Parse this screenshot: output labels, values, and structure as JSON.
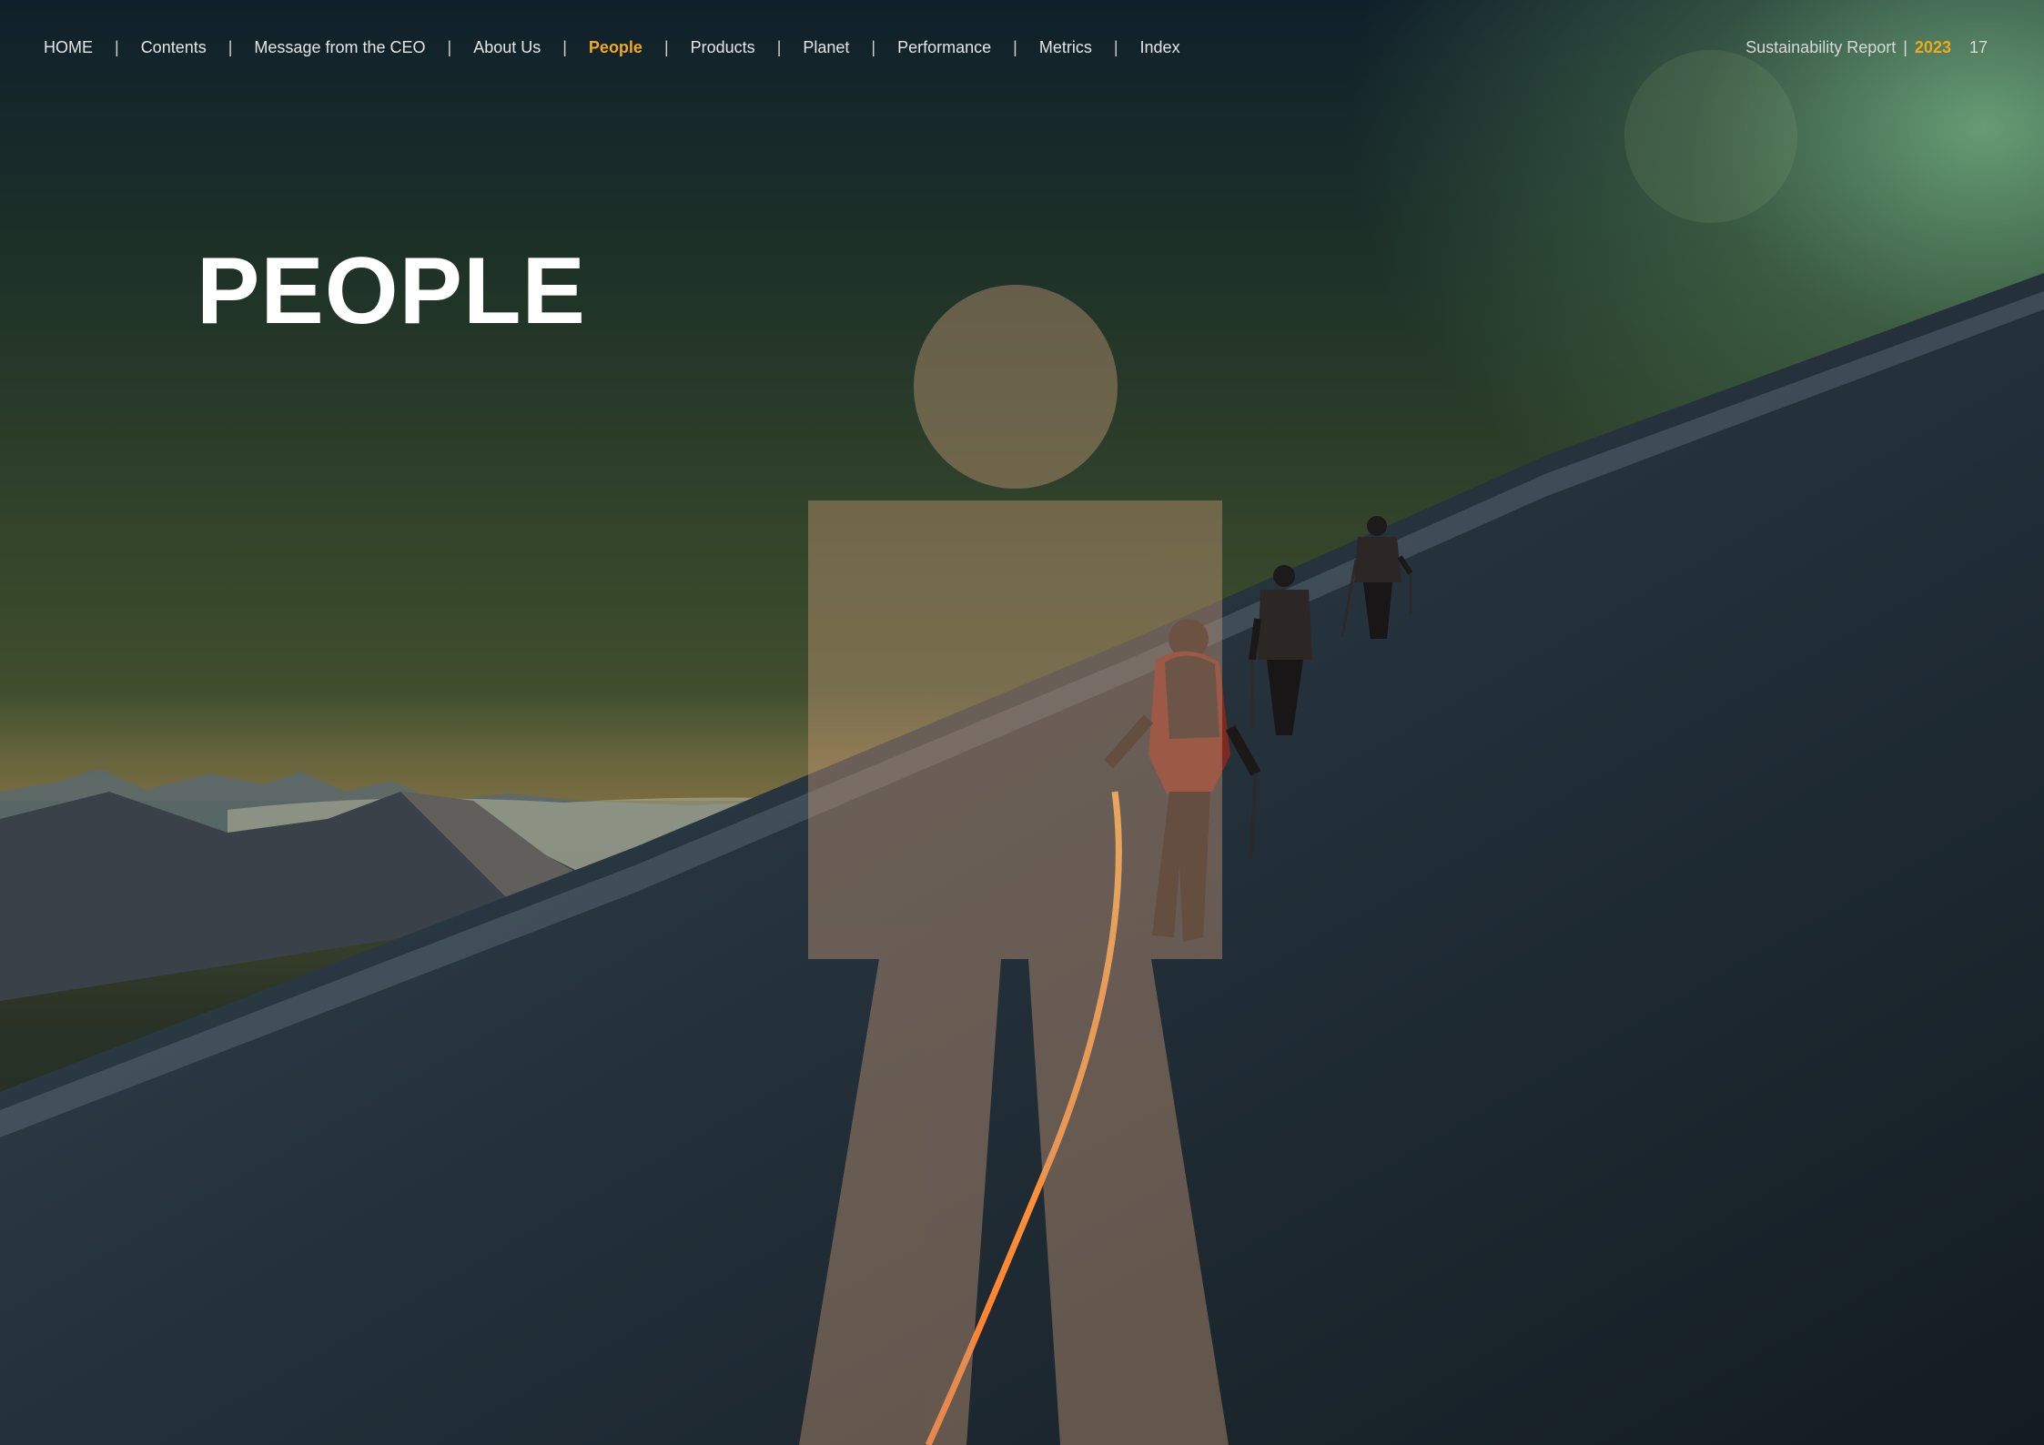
{
  "nav": {
    "items": [
      {
        "label": "HOME",
        "active": false
      },
      {
        "label": "Contents",
        "active": false
      },
      {
        "label": "Message from the CEO",
        "active": false
      },
      {
        "label": "About Us",
        "active": false
      },
      {
        "label": "People",
        "active": true
      },
      {
        "label": "Products",
        "active": false
      },
      {
        "label": "Planet",
        "active": false
      },
      {
        "label": "Performance",
        "active": false
      },
      {
        "label": "Metrics",
        "active": false
      },
      {
        "label": "Index",
        "active": false
      }
    ],
    "separator": "|"
  },
  "report": {
    "title": "Sustainability Report",
    "separator": "|",
    "year": "2023",
    "page_number": "17"
  },
  "page": {
    "title": "PEOPLE"
  },
  "colors": {
    "accent": "#f2a91a",
    "text": "#ffffff",
    "sky_glow": "#74b082",
    "figure_overlay": "#c89a7a"
  },
  "icons": {
    "person_figure": "person-silhouette-icon"
  }
}
